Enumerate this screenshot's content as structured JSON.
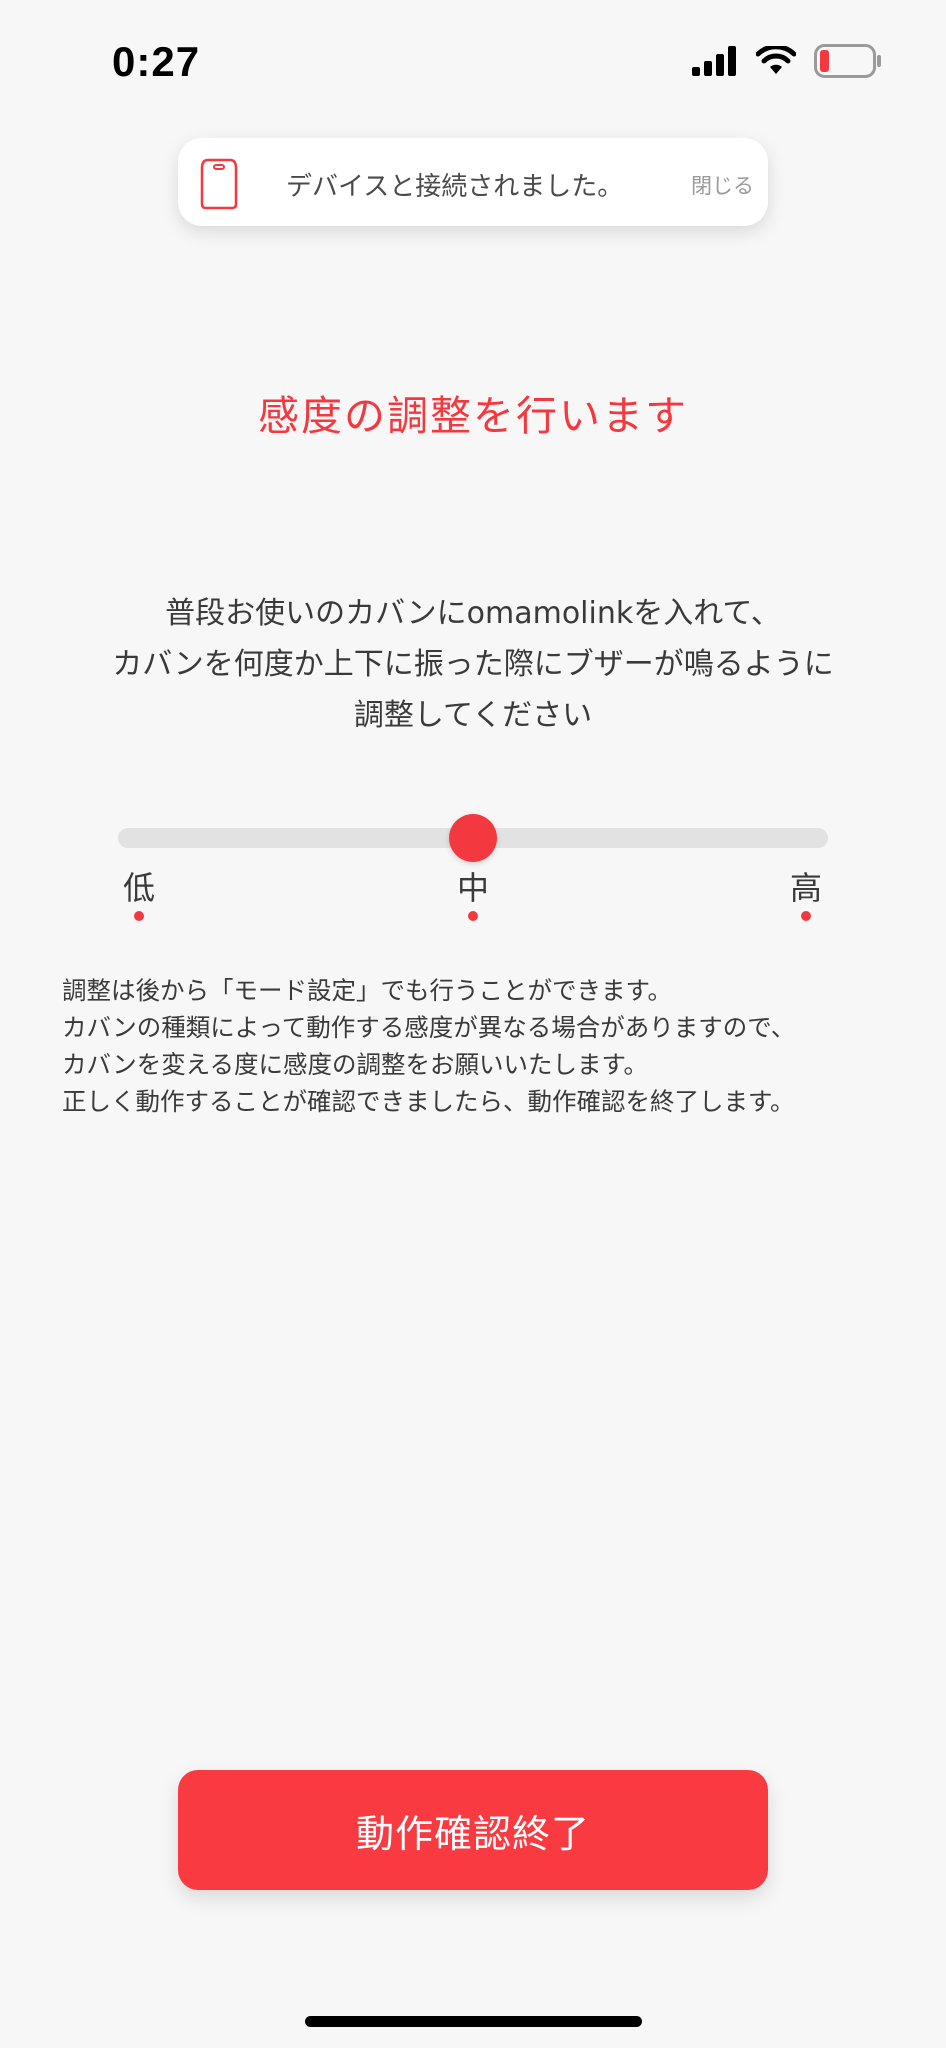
{
  "status_bar": {
    "time": "0:27"
  },
  "toast": {
    "icon": "device-tag-icon",
    "message": "デバイスと接続されました。",
    "close_label": "閉じる"
  },
  "page_title": "感度の調整を行います",
  "instruction": [
    "普段お使いのカバンにomamolinkを入れて、",
    "カバンを何度か上下に振った際にブザーが鳴るように",
    "調整してください"
  ],
  "sensitivity_slider": {
    "value": 0.5,
    "labels": {
      "low": "低",
      "mid": "中",
      "high": "高"
    }
  },
  "notes": [
    "調整は後から「モード設定」でも行うことができます。",
    "カバンの種類によって動作する感度が異なる場合がありますので、",
    "カバンを変える度に感度の調整をお願いいたします。",
    "正しく動作することが確認できましたら、動作確認を終了します。"
  ],
  "finish_button_label": "動作確認終了",
  "colors": {
    "accent": "#f3393f",
    "background": "#f7f7f7"
  }
}
